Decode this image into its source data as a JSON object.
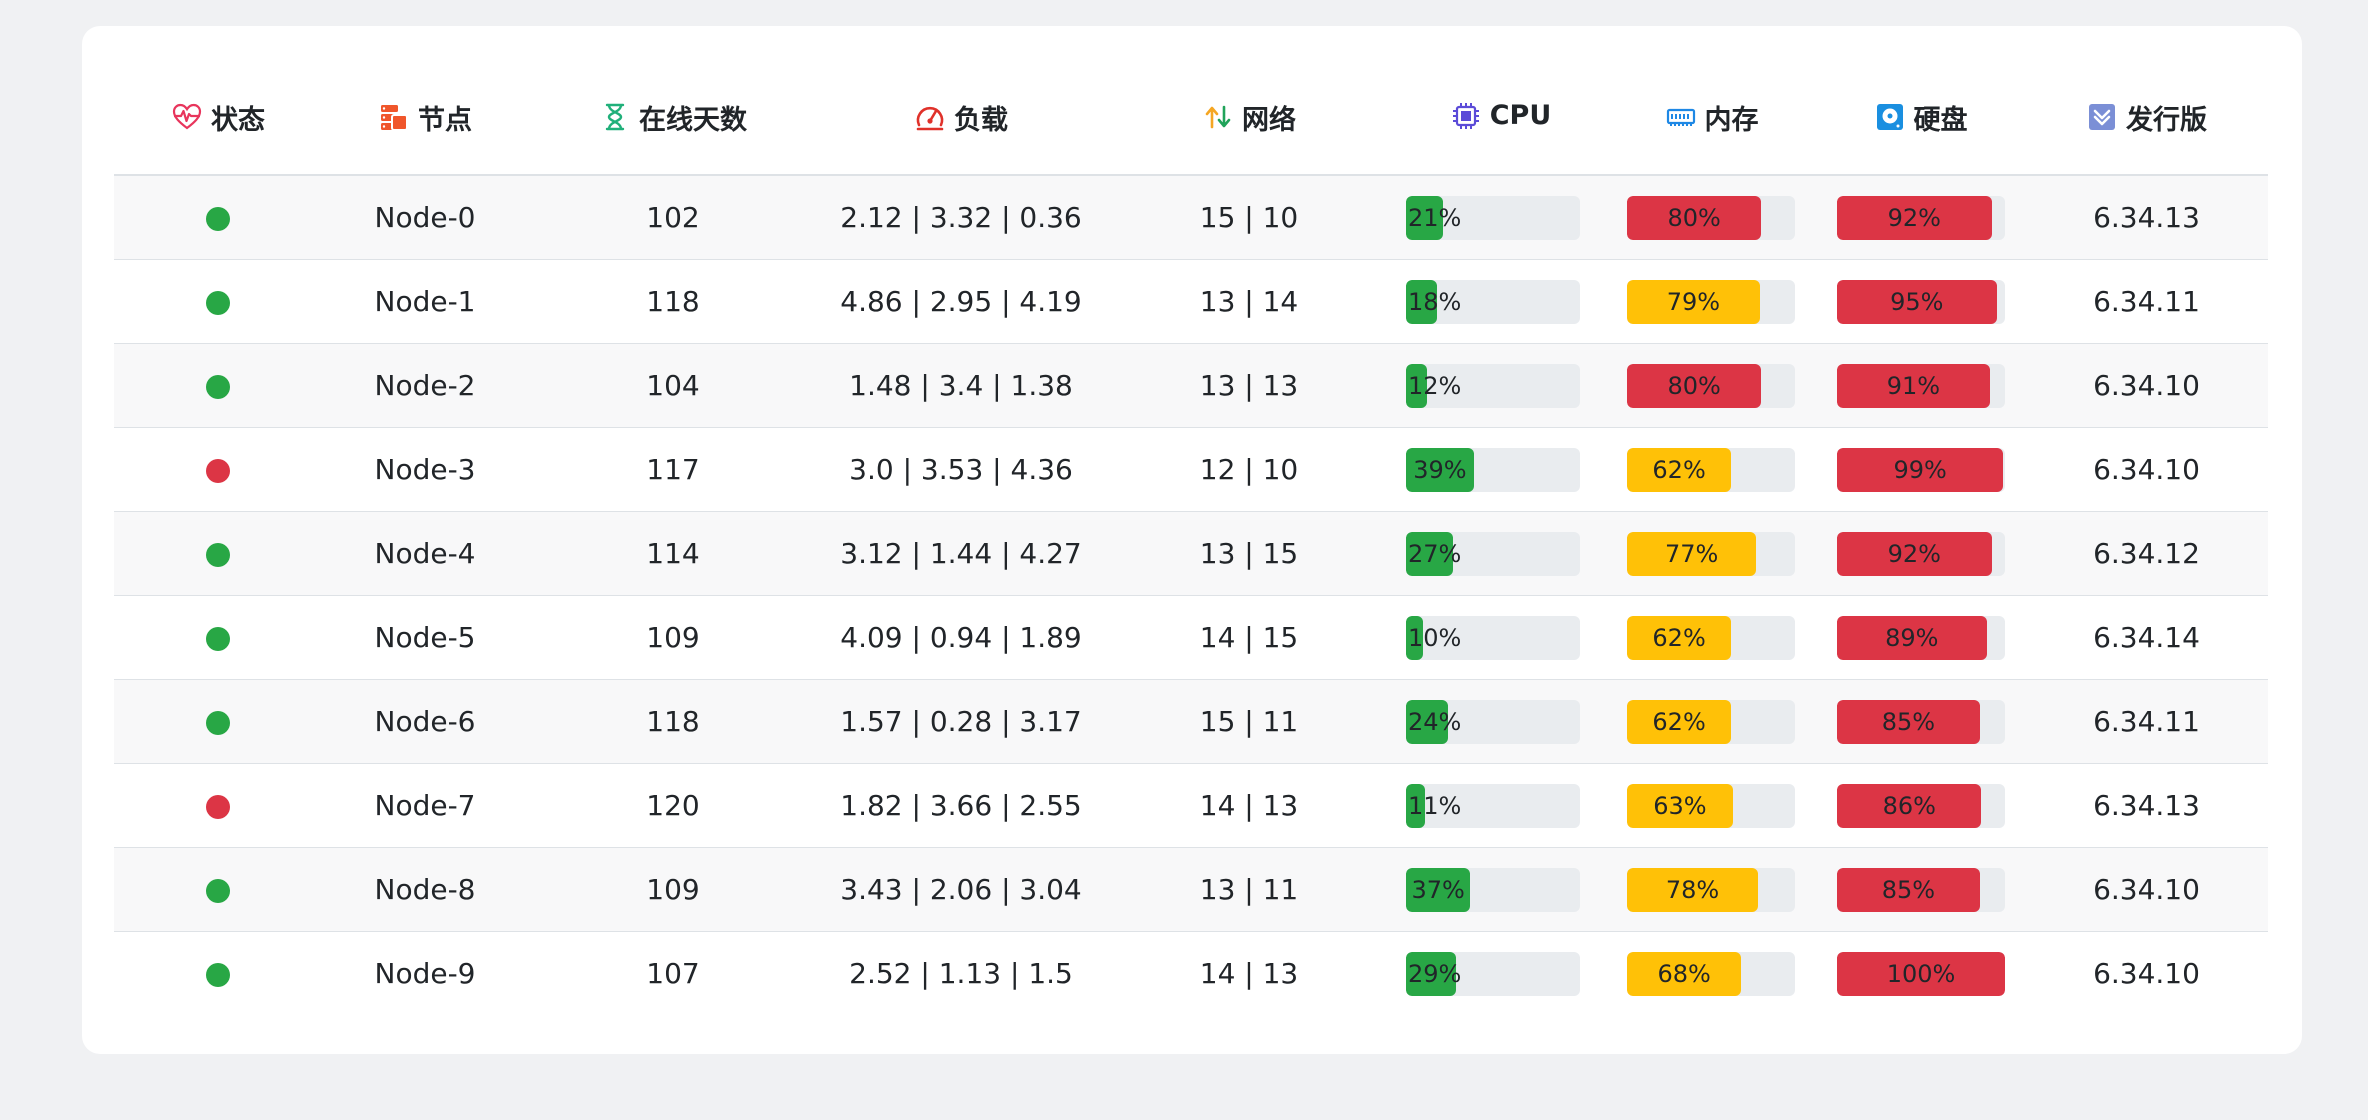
{
  "headers": {
    "status": "状态",
    "node": "节点",
    "uptime": "在线天数",
    "load": "负载",
    "network": "网络",
    "cpu": "CPU",
    "memory": "内存",
    "disk": "硬盘",
    "release": "发行版"
  },
  "colors": {
    "online": "#28a745",
    "offline": "#dc3545",
    "bar_green": "#28a745",
    "bar_yellow": "#ffc107",
    "bar_red": "#dc3545",
    "track": "#e9ecef"
  },
  "icons": {
    "status": "heart-pulse-icon",
    "node": "server-stack-icon",
    "uptime": "hourglass-icon",
    "load": "speedometer-icon",
    "network": "arrows-up-down-icon",
    "cpu": "cpu-chip-icon",
    "memory": "memory-module-icon",
    "disk": "hard-disk-icon",
    "release": "download-box-icon"
  },
  "rows": [
    {
      "status": "online",
      "node": "Node-0",
      "uptime": "102",
      "load": "2.12 | 3.32 | 0.36",
      "network": "15 | 10",
      "cpu": 21,
      "cpu_label": "21%",
      "memory": 80,
      "memory_label": "80%",
      "disk": 92,
      "disk_label": "92%",
      "release": "6.34.13"
    },
    {
      "status": "online",
      "node": "Node-1",
      "uptime": "118",
      "load": "4.86 | 2.95 | 4.19",
      "network": "13 | 14",
      "cpu": 18,
      "cpu_label": "18%",
      "memory": 79,
      "memory_label": "79%",
      "disk": 95,
      "disk_label": "95%",
      "release": "6.34.11"
    },
    {
      "status": "online",
      "node": "Node-2",
      "uptime": "104",
      "load": "1.48 | 3.4 | 1.38",
      "network": "13 | 13",
      "cpu": 12,
      "cpu_label": "12%",
      "memory": 80,
      "memory_label": "80%",
      "disk": 91,
      "disk_label": "91%",
      "release": "6.34.10"
    },
    {
      "status": "offline",
      "node": "Node-3",
      "uptime": "117",
      "load": "3.0 | 3.53 | 4.36",
      "network": "12 | 10",
      "cpu": 39,
      "cpu_label": "39%",
      "memory": 62,
      "memory_label": "62%",
      "disk": 99,
      "disk_label": "99%",
      "release": "6.34.10"
    },
    {
      "status": "online",
      "node": "Node-4",
      "uptime": "114",
      "load": "3.12 | 1.44 | 4.27",
      "network": "13 | 15",
      "cpu": 27,
      "cpu_label": "27%",
      "memory": 77,
      "memory_label": "77%",
      "disk": 92,
      "disk_label": "92%",
      "release": "6.34.12"
    },
    {
      "status": "online",
      "node": "Node-5",
      "uptime": "109",
      "load": "4.09 | 0.94 | 1.89",
      "network": "14 | 15",
      "cpu": 10,
      "cpu_label": "10%",
      "memory": 62,
      "memory_label": "62%",
      "disk": 89,
      "disk_label": "89%",
      "release": "6.34.14"
    },
    {
      "status": "online",
      "node": "Node-6",
      "uptime": "118",
      "load": "1.57 | 0.28 | 3.17",
      "network": "15 | 11",
      "cpu": 24,
      "cpu_label": "24%",
      "memory": 62,
      "memory_label": "62%",
      "disk": 85,
      "disk_label": "85%",
      "release": "6.34.11"
    },
    {
      "status": "offline",
      "node": "Node-7",
      "uptime": "120",
      "load": "1.82 | 3.66 | 2.55",
      "network": "14 | 13",
      "cpu": 11,
      "cpu_label": "11%",
      "memory": 63,
      "memory_label": "63%",
      "disk": 86,
      "disk_label": "86%",
      "release": "6.34.13"
    },
    {
      "status": "online",
      "node": "Node-8",
      "uptime": "109",
      "load": "3.43 | 2.06 | 3.04",
      "network": "13 | 11",
      "cpu": 37,
      "cpu_label": "37%",
      "memory": 78,
      "memory_label": "78%",
      "disk": 85,
      "disk_label": "85%",
      "release": "6.34.10"
    },
    {
      "status": "online",
      "node": "Node-9",
      "uptime": "107",
      "load": "2.52 | 1.13 | 1.5",
      "network": "14 | 13",
      "cpu": 29,
      "cpu_label": "29%",
      "memory": 68,
      "memory_label": "68%",
      "disk": 100,
      "disk_label": "100%",
      "release": "6.34.10"
    }
  ]
}
